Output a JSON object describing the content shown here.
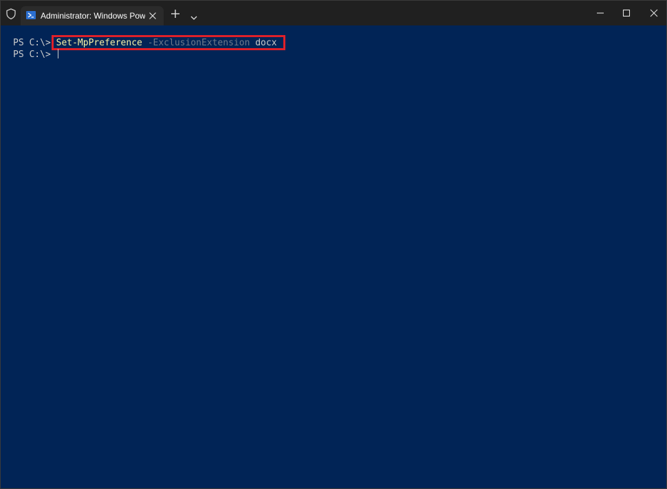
{
  "window": {
    "tab_title": "Administrator: Windows Powe",
    "icons": {
      "shield": "shield-icon",
      "tab": "powershell-icon",
      "tab_close": "close-icon",
      "new_tab": "plus-icon",
      "dropdown": "chevron-down-icon",
      "minimize": "minimize-icon",
      "maximize": "maximize-icon",
      "close": "close-icon"
    }
  },
  "terminal": {
    "lines": [
      {
        "prompt": "PS C:\\> ",
        "cmdlet": "Set-MpPreference",
        "parameter": "-ExclusionExtension",
        "argument": "docx"
      },
      {
        "prompt": "PS C:\\> "
      }
    ],
    "colors": {
      "background": "#012456",
      "cmdlet": "#f9f1a5",
      "parameter": "#6e7a8c",
      "text": "#cccccc",
      "highlight_border": "#e02029"
    }
  }
}
